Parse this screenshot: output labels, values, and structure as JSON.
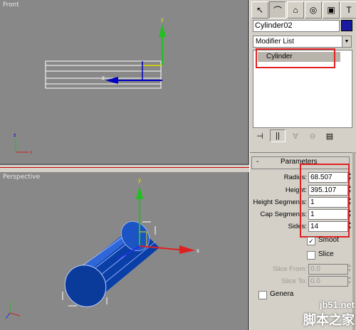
{
  "viewports": {
    "front": {
      "label": "Front"
    },
    "perspective": {
      "label": "Perspective"
    }
  },
  "axes": {
    "x": "x",
    "y": "y",
    "z": "z"
  },
  "command_panel": {
    "tabs": [
      {
        "icon": "create-cursor-icon"
      },
      {
        "icon": "modify-icon"
      },
      {
        "icon": "hierarchy-icon"
      },
      {
        "icon": "motion-icon"
      },
      {
        "icon": "display-icon"
      },
      {
        "icon": "utilities-hammer-icon"
      }
    ],
    "object_name": "Cylinder02",
    "object_color": "#1a1aa0",
    "modifier_list": "Modifier List",
    "stack_item": "Cylinder",
    "rollout_title": "Parameters",
    "rollout_toggle": "-",
    "params": [
      {
        "label": "Radius:",
        "value": "68.507"
      },
      {
        "label": "Height:",
        "value": "395.107"
      },
      {
        "label": "Height Segments:",
        "value": "1"
      },
      {
        "label": "Cap Segments:",
        "value": "1"
      },
      {
        "label": "Sides:",
        "value": "14"
      }
    ],
    "checks": [
      {
        "label": "Smoot",
        "checked": "✓"
      },
      {
        "label": "Slice",
        "checked": ""
      }
    ],
    "slice_params": [
      {
        "label": "Slice From:",
        "value": "0.0"
      },
      {
        "label": "Slice To:",
        "value": "0.0"
      }
    ],
    "generate_label": "Genera"
  },
  "watermark": {
    "site": "jb51.net",
    "name": "脚本之家"
  },
  "highlight_color": "#e02020"
}
